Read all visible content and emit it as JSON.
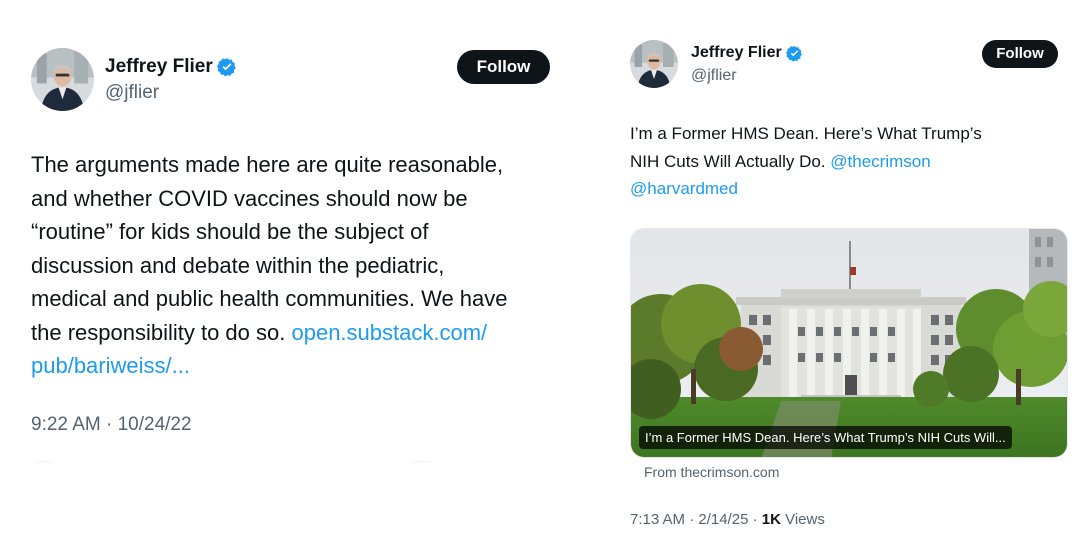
{
  "tweet_left": {
    "author_name": "Jeffrey Flier",
    "handle": "@jflier",
    "follow_label": "Follow",
    "text_lines": [
      "The arguments made here are quite reasonable,",
      "and whether COVID vaccines should now be",
      "“routine” for kids should be the subject of",
      "discussion and debate within the pediatric,",
      "medical and public health communities. We have",
      "the responsibility to do so. "
    ],
    "link_part1": "open.substack.com/",
    "link_part2": "pub/bariweiss/...",
    "timestamp": "9:22 AM · 10/24/22"
  },
  "tweet_right": {
    "author_name": "Jeffrey Flier",
    "handle": "@jflier",
    "follow_label": "Follow",
    "text_line1": "I’m a Former HMS Dean. Here’s What Trump’s",
    "text_line2": "NIH Cuts Will Actually Do. ",
    "mention1": "@thecrimson",
    "mention2": "@harvardmed",
    "card_caption": "I’m a Former HMS Dean. Here’s What Trump’s NIH Cuts Will...",
    "card_source": "From thecrimson.com",
    "timestamp": "7:13 AM · 2/14/25 · ",
    "views_count": "1K",
    "views_label": " Views"
  },
  "icons": {
    "verified": "verified-badge-icon",
    "avatar": "profile-photo"
  },
  "colors": {
    "text": "#0f1419",
    "secondary": "#536471",
    "link": "#1d9bf0",
    "verified": "#1d9bf0",
    "button_bg": "#0f1419",
    "button_text": "#ffffff"
  }
}
